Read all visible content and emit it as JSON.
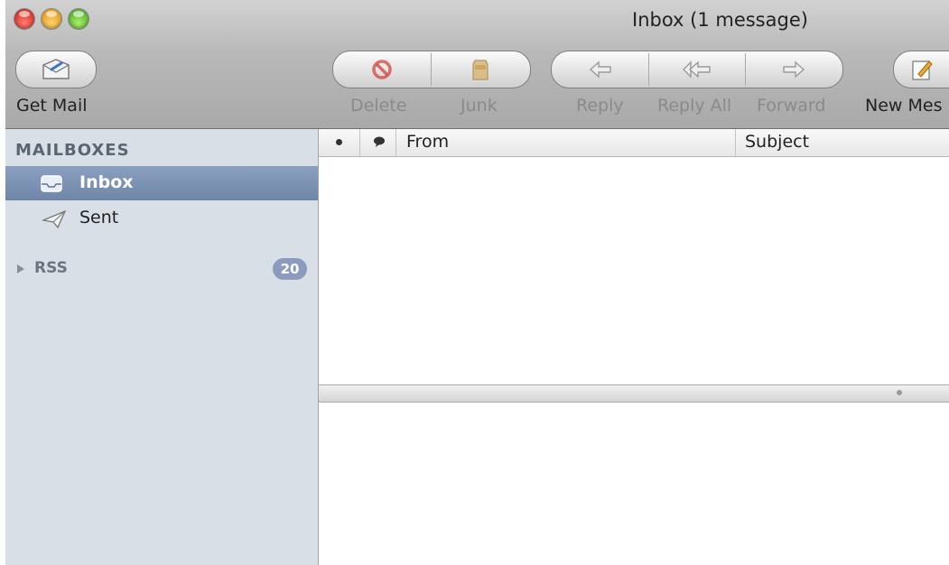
{
  "window": {
    "title": "Inbox (1 message)"
  },
  "toolbar": {
    "get_mail": {
      "label": "Get Mail",
      "icon": "envelope-icon"
    },
    "delete": {
      "label": "Delete",
      "icon": "no-entry-icon"
    },
    "junk": {
      "label": "Junk",
      "icon": "junk-bag-icon"
    },
    "reply": {
      "label": "Reply",
      "icon": "reply-arrow-icon"
    },
    "reply_all": {
      "label": "Reply All",
      "icon": "reply-all-arrow-icon"
    },
    "forward": {
      "label": "Forward",
      "icon": "forward-arrow-icon"
    },
    "new_message": {
      "label": "New Mes",
      "icon": "compose-icon"
    }
  },
  "sidebar": {
    "header": "MAILBOXES",
    "items": [
      {
        "label": "Inbox",
        "icon": "inbox-tray-icon",
        "selected": true
      },
      {
        "label": "Sent",
        "icon": "paper-plane-icon",
        "selected": false
      },
      {
        "label": "RSS",
        "icon": "disclosure-triangle-icon",
        "badge": "20"
      }
    ]
  },
  "message_list": {
    "columns": [
      "From",
      "Subject"
    ],
    "status_column_icons": [
      "unread-dot-icon",
      "speech-bubble-icon"
    ]
  },
  "colors": {
    "selected_row": "#7a8fb2",
    "sidebar_bg": "#d9dfe6",
    "badge_bg": "#8b9bbd",
    "delete_icon": "#d2453d",
    "junk_icon": "#c9a35c"
  }
}
